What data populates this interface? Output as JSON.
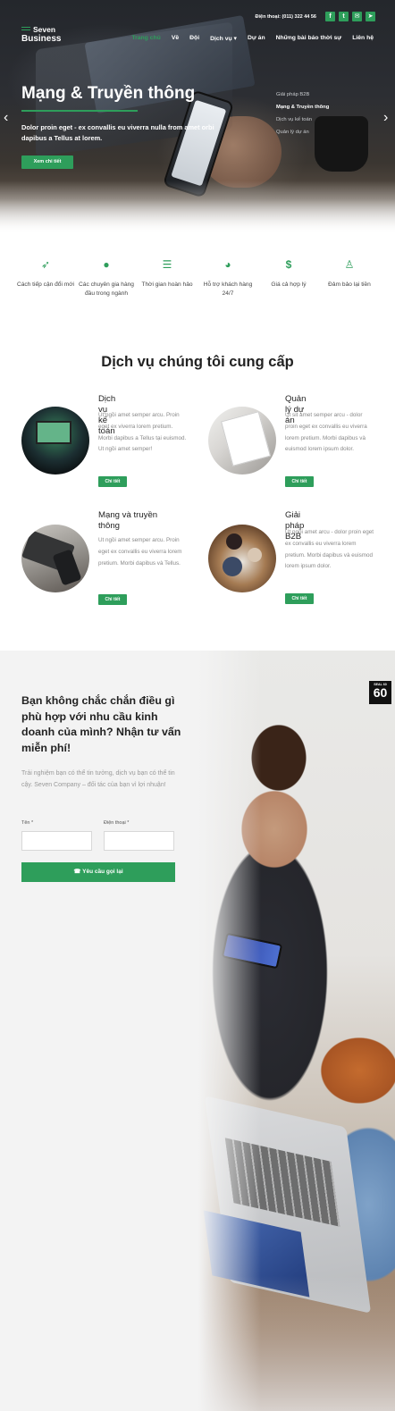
{
  "header": {
    "phone": "Điện thoại: (011) 322 44 56",
    "social_icons": [
      "f",
      "t",
      "✉",
      "➤"
    ],
    "logo_top": "Seven",
    "logo_bottom": "Business",
    "nav": [
      "Trang chủ",
      "Về",
      "Đội",
      "Dịch vụ ▾",
      "Dự án",
      "Những bài báo thời sự",
      "Liên hệ"
    ]
  },
  "hero": {
    "title": "Mạng & Truyền thông",
    "subtitle": "Dolor proin eget - ex convallis eu viverra nulla from amet orbi dapibus a Tellus at lorem.",
    "button": "Xem chi tiết",
    "side_list": [
      "Giải pháp B2B",
      "Mạng & Truyền thông",
      "Dịch vụ kế toán",
      "Quản lý dự án"
    ],
    "prev_arrow": "‹",
    "next_arrow": "›"
  },
  "features": [
    {
      "icon": "rocket-icon",
      "glyph": "➶",
      "label": "Cách tiếp cận đổi mới"
    },
    {
      "icon": "user-icon",
      "glyph": "●",
      "label": "Các chuyên gia hàng đầu trong ngành"
    },
    {
      "icon": "checklist-icon",
      "glyph": "☰",
      "label": "Thời gian hoàn hảo"
    },
    {
      "icon": "headset-icon",
      "glyph": "◕",
      "label": "Hỗ trợ khách hàng 24/7"
    },
    {
      "icon": "dollar-icon",
      "glyph": "$",
      "label": "Giá cả hợp lý"
    },
    {
      "icon": "medal-icon",
      "glyph": "♙",
      "label": "Đảm bảo lại tiền"
    }
  ],
  "services": {
    "title": "Dịch vụ chúng tôi cung cấp",
    "items": [
      {
        "title": "Dịch vụ kế toán",
        "desc": "Ut ngồi amet semper arcu. Proin eget ex viverra lorem pretium. Morbi dapibus a Tellus tại euismod. Ut ngồi amet semper!",
        "button": "Chi tiết"
      },
      {
        "title": "Quản lý dự án",
        "desc": "Ut sit amet semper arcu - dolor proin eget ex convallis eu viverra lorem pretium. Morbi dapibus và euismod lorem ipsum dolor.",
        "button": "Chi tiết"
      },
      {
        "title": "Mạng và truyền thông",
        "desc": "Ut ngồi amet semper arcu. Proin eget ex convallis eu viverra lorem pretium. Morbi dapibus và Tellus.",
        "button": "Chi tiết"
      },
      {
        "title": "Giải pháp B2B",
        "desc": "Ut ngồi amet arcu - dolor proin eget ex convallis eu viverra lorem pretium. Morbi dapibus và euismod lorem ipsum dolor.",
        "button": "Chi tiết"
      }
    ]
  },
  "consult": {
    "title": "Bạn không chắc chắn điều gì phù hợp với nhu cầu kinh doanh của mình? Nhận tư vấn miễn phí!",
    "desc": "Trải nghiệm bạn có thể tin tưởng, dịch vụ bạn có thể tin cậy. Seven Company – đối tác của bạn vì lợi nhuận!",
    "name_label": "Tên *",
    "name_value": "",
    "phone_label": "Điện thoại *",
    "phone_value": "",
    "button": "☎ Yêu cầu gọi lại",
    "badge_small": "SEAL 60",
    "badge_big": "60"
  },
  "colors": {
    "accent": "#2e9e5b",
    "dark": "#222222",
    "muted": "#999999",
    "section_bg": "#f3f3f3"
  }
}
